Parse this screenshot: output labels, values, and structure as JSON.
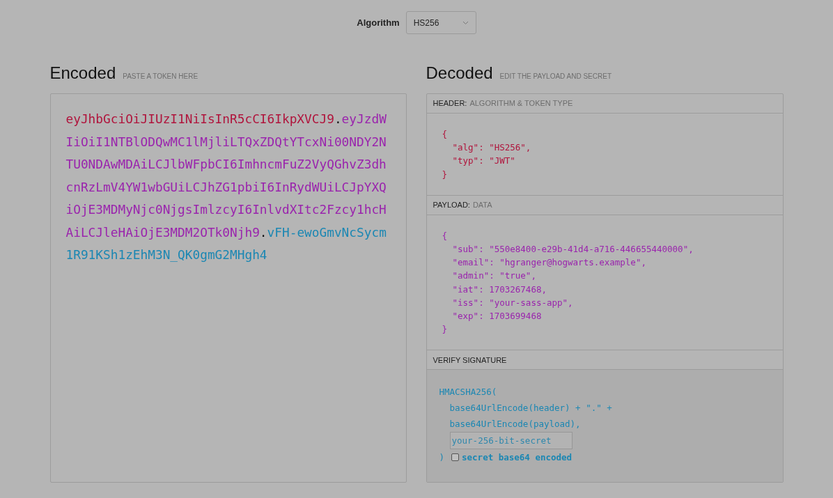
{
  "algorithm": {
    "label": "Algorithm",
    "value": "HS256"
  },
  "encoded": {
    "title": "Encoded",
    "hint": "PASTE A TOKEN HERE",
    "segments": [
      {
        "kind": "header",
        "text": "eyJhbGciOiJIUzI1NiIsInR5cCI6IkpXVCJ9"
      },
      {
        "kind": "dot",
        "text": "."
      },
      {
        "kind": "payload",
        "text": "eyJzdWIiOiI1NTBlODQwMC1lMjliLTQxZDQtYTcxNi00NDY2NTU0NDAwMDAiLCJlbWFpbCI6ImhncmFuZ2VyQGhvZ3dhcnRzLmV4YW1wbGUiLCJhZG1pbiI6InRydWUiLCJpYXQiOjE3MDMyNjc0NjgsImlzcyI6InlvdXItc2Fzcy1hcHAiLCJleHAiOjE3MDM2OTk0Njh9"
      },
      {
        "kind": "dot",
        "text": "."
      },
      {
        "kind": "signature",
        "text": "vFH-ewoGmvNcSycm1R91KSh1zEhM3N_QK0gmG2MHgh4"
      }
    ]
  },
  "decoded": {
    "title": "Decoded",
    "hint": "EDIT THE PAYLOAD AND SECRET",
    "sections": [
      {
        "kind": "header",
        "label": "HEADER:",
        "hint": "ALGORITHM & TOKEN TYPE",
        "open": "{",
        "entries": [
          "\"alg\": \"HS256\",",
          "\"typ\": \"JWT\""
        ],
        "close": "}"
      },
      {
        "kind": "payload",
        "label": "PAYLOAD:",
        "hint": "DATA",
        "open": "{",
        "entries": [
          "\"sub\": \"550e8400-e29b-41d4-a716-446655440000\",",
          "\"email\": \"hgranger@hogwarts.example\",",
          "\"admin\": \"true\",",
          "\"iat\": 1703267468,",
          "\"iss\": \"your-sass-app\",",
          "\"exp\": 1703699468"
        ],
        "close": "}"
      },
      {
        "kind": "verify",
        "label": "VERIFY SIGNATURE",
        "open": "HMACSHA256(",
        "entries": [
          "base64UrlEncode(header) + \".\" +",
          "base64UrlEncode(payload),"
        ],
        "secret": "your-256-bit-secret",
        "close": ")",
        "base64": {
          "label": "secret base64 encoded",
          "checked": false
        }
      }
    ]
  }
}
